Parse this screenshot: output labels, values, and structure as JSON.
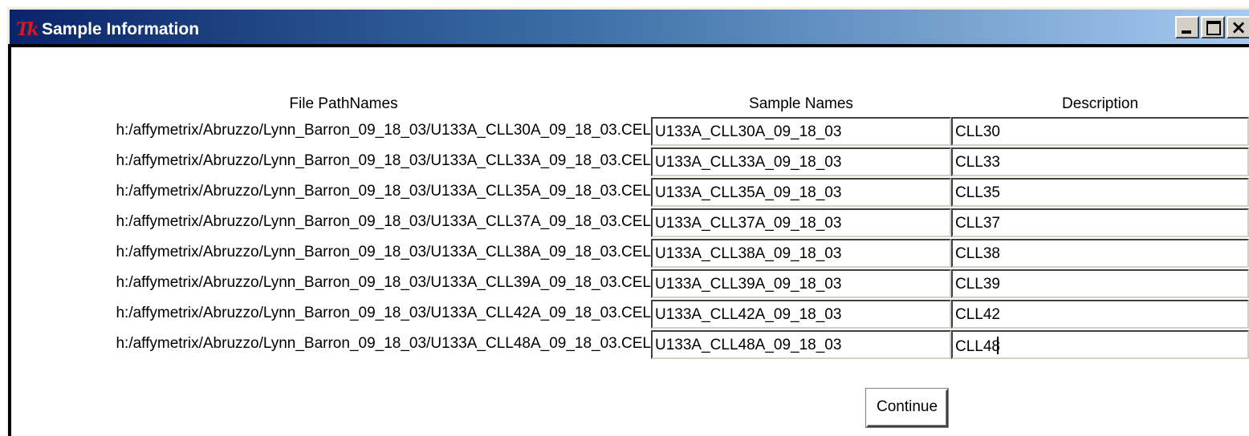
{
  "window": {
    "title": "Sample Information",
    "logo_text": "Tk",
    "close_glyph": "×"
  },
  "headers": {
    "path": "File PathNames",
    "name": "Sample Names",
    "description": "Description"
  },
  "rows": [
    {
      "path": "h:/affymetrix/Abruzzo/Lynn_Barron_09_18_03/U133A_CLL30A_09_18_03.CEL",
      "name": "U133A_CLL30A_09_18_03",
      "description": "CLL30"
    },
    {
      "path": "h:/affymetrix/Abruzzo/Lynn_Barron_09_18_03/U133A_CLL33A_09_18_03.CEL",
      "name": "U133A_CLL33A_09_18_03",
      "description": "CLL33"
    },
    {
      "path": "h:/affymetrix/Abruzzo/Lynn_Barron_09_18_03/U133A_CLL35A_09_18_03.CEL",
      "name": "U133A_CLL35A_09_18_03",
      "description": "CLL35"
    },
    {
      "path": "h:/affymetrix/Abruzzo/Lynn_Barron_09_18_03/U133A_CLL37A_09_18_03.CEL",
      "name": "U133A_CLL37A_09_18_03",
      "description": "CLL37"
    },
    {
      "path": "h:/affymetrix/Abruzzo/Lynn_Barron_09_18_03/U133A_CLL38A_09_18_03.CEL",
      "name": "U133A_CLL38A_09_18_03",
      "description": "CLL38"
    },
    {
      "path": "h:/affymetrix/Abruzzo/Lynn_Barron_09_18_03/U133A_CLL39A_09_18_03.CEL",
      "name": "U133A_CLL39A_09_18_03",
      "description": "CLL39"
    },
    {
      "path": "h:/affymetrix/Abruzzo/Lynn_Barron_09_18_03/U133A_CLL42A_09_18_03.CEL",
      "name": "U133A_CLL42A_09_18_03",
      "description": "CLL42"
    },
    {
      "path": "h:/affymetrix/Abruzzo/Lynn_Barron_09_18_03/U133A_CLL48A_09_18_03.CEL",
      "name": "U133A_CLL48A_09_18_03",
      "description": "CLL48"
    }
  ],
  "continue_label": "Continue"
}
